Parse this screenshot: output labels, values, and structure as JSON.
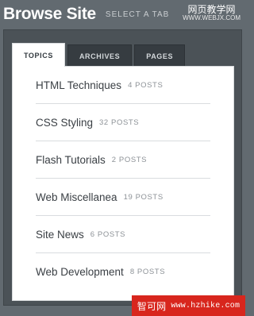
{
  "header": {
    "title": "Browse Site",
    "subtitle": "SELECT A TAB"
  },
  "watermark_top": {
    "line1": "网页教学网",
    "line2": "WWW.WEBJX.COM"
  },
  "tabs": [
    {
      "label": "TOPICS",
      "active": true
    },
    {
      "label": "ARCHIVES",
      "active": false
    },
    {
      "label": "PAGES",
      "active": false
    }
  ],
  "topics": [
    {
      "name": "HTML Techniques",
      "count": "4 POSTS"
    },
    {
      "name": "CSS Styling",
      "count": "32 POSTS"
    },
    {
      "name": "Flash Tutorials",
      "count": "2 POSTS"
    },
    {
      "name": "Web Miscellanea",
      "count": "19 POSTS"
    },
    {
      "name": "Site News",
      "count": "6 POSTS"
    },
    {
      "name": "Web Development",
      "count": "8 POSTS"
    }
  ],
  "watermark_bottom": {
    "text1": "智可网",
    "text2": "www.hzhike.com"
  },
  "colors": {
    "background": "#626a70",
    "panel": "#4b5257",
    "tab_inactive": "#363c41",
    "watermark_red": "#d8261d"
  }
}
